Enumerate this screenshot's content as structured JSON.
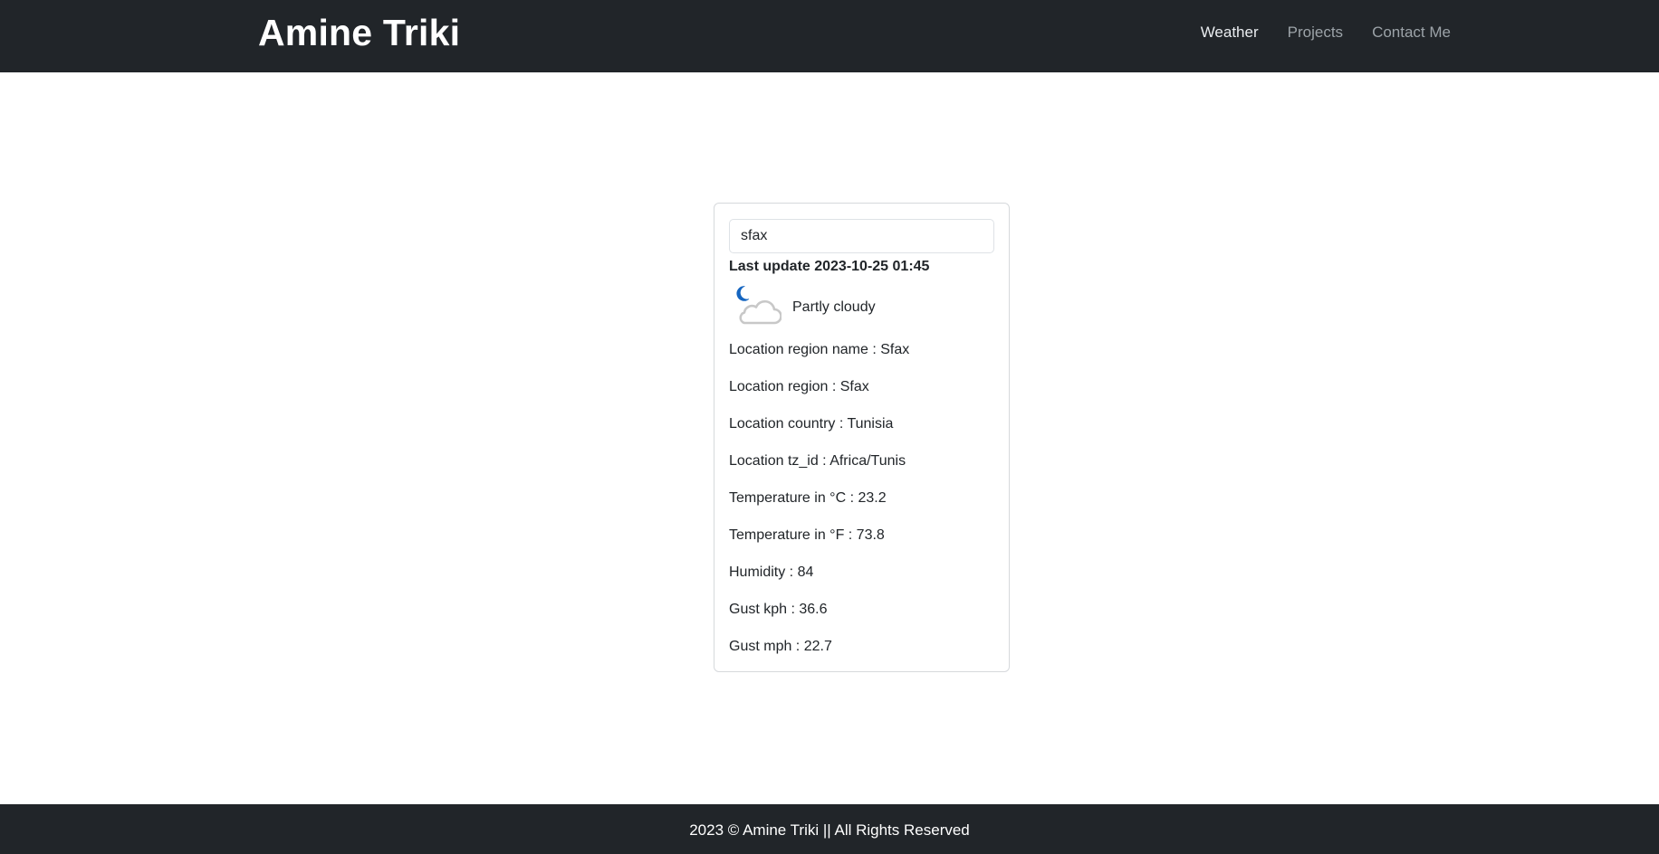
{
  "navbar": {
    "brand": "Amine Triki",
    "links": [
      {
        "label": "Weather",
        "active": true
      },
      {
        "label": "Projects",
        "active": false
      },
      {
        "label": "Contact Me",
        "active": false
      }
    ]
  },
  "weather": {
    "search": {
      "value": "sfax"
    },
    "last_update_label": "Last update 2023-10-25 01:45",
    "condition": {
      "text": "Partly cloudy",
      "icon": "moon-cloud-icon"
    },
    "details": [
      "Location region name : Sfax",
      "Location region : Sfax",
      "Location country : Tunisia",
      "Location tz_id : Africa/Tunis",
      "Temperature in °C : 23.2",
      "Temperature in °F : 73.8",
      "Humidity : 84",
      "Gust kph : 36.6",
      "Gust mph : 22.7"
    ]
  },
  "footer": {
    "text": "2023 © Amine Triki || All Rights Reserved"
  },
  "colors": {
    "navbar_bg": "#212529",
    "nav_active": "#e9ecef",
    "nav_inactive": "#9ca3a8",
    "moon_blue": "#1565c0",
    "cloud_stroke": "#c8c8c8"
  }
}
